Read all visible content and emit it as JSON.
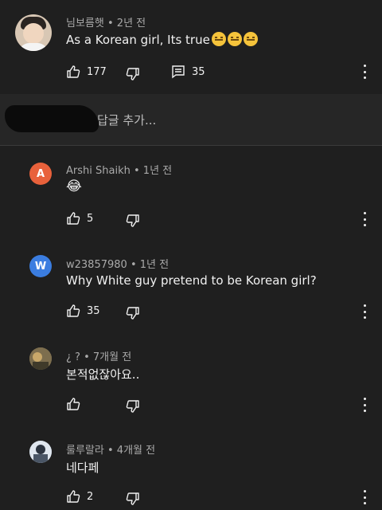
{
  "top_comment": {
    "author": "님보름햇",
    "time": "2년 전",
    "text": "As a Korean girl, Its true",
    "emoji_count": 3,
    "likes": "177",
    "replies": "35"
  },
  "reply_input": {
    "placeholder": "답글 추가..."
  },
  "replies": [
    {
      "author": "Arshi Shaikh",
      "time": "1년 전",
      "avatar_letter": "A",
      "avatar_color": "#e8613b",
      "text": "😂",
      "likes": "5"
    },
    {
      "author": "w23857980",
      "time": "1년 전",
      "avatar_letter": "W",
      "avatar_color": "#3b7de0",
      "text": "Why White guy pretend to be Korean girl?",
      "likes": "35"
    },
    {
      "author": "¿ ?",
      "time": "7개월 전",
      "avatar_letter": "",
      "avatar_color": "#8b7a5a",
      "text": "본적없잖아요..",
      "likes": ""
    },
    {
      "author": "룰루랄라",
      "time": "4개월 전",
      "avatar_letter": "",
      "avatar_color": "#6a7a8c",
      "text": "네다페",
      "likes": "2"
    }
  ],
  "colors": {
    "background": "#1f1f1f",
    "text": "#f1f1f1",
    "meta": "#aaaaaa"
  }
}
